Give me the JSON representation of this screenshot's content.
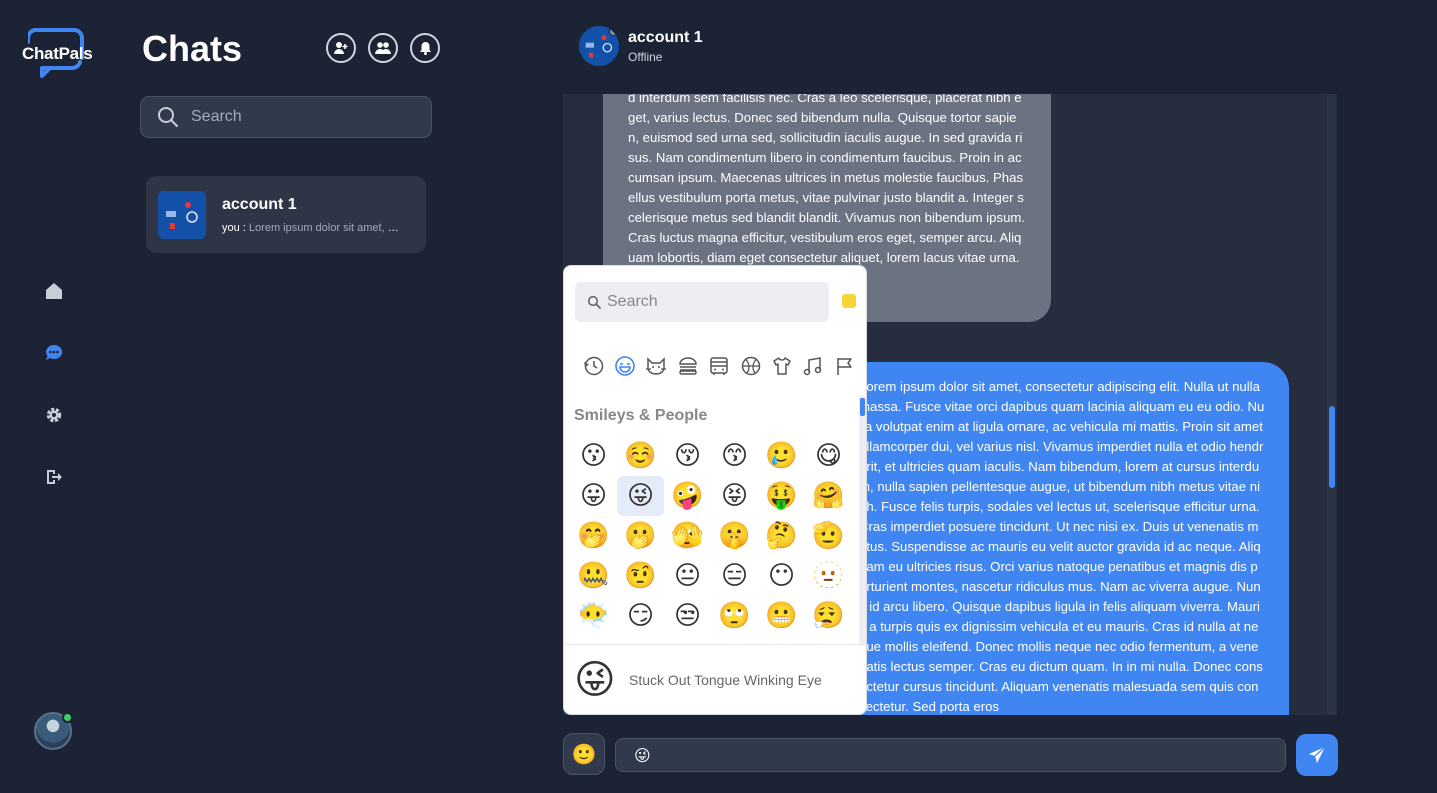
{
  "app": {
    "logo_text": "ChatPals",
    "accent_color": "#3f86f2",
    "background_color": "#1b2335"
  },
  "rail": {
    "items": [
      {
        "icon": "home-icon",
        "active": false
      },
      {
        "icon": "chat-icon",
        "active": true
      },
      {
        "icon": "gear-icon",
        "active": false
      },
      {
        "icon": "logout-icon",
        "active": false
      }
    ],
    "user_online": true
  },
  "chats_panel": {
    "title": "Chats",
    "header_buttons": [
      "add-user-icon",
      "group-icon",
      "bell-icon"
    ],
    "search_placeholder": "Search",
    "conversations": [
      {
        "name": "account 1",
        "preview_prefix": "you :",
        "preview_text": "Lorem ipsum dolor sit amet, consectetur adipiscing elit."
      }
    ]
  },
  "conversation": {
    "contact_name": "account 1",
    "contact_status": "Offline",
    "messages": [
      {
        "direction": "incoming",
        "text": "d interdum sem facilisis nec. Cras a leo scelerisque, placerat nibh eget, varius lectus. Donec sed bibendum nulla. Quisque tortor sapien, euismod sed urna sed, sollicitudin iaculis augue. In sed gravida risus. Nam condimentum libero in condimentum faucibus. Proin in accumsan ipsum. Maecenas ultrices in metus molestie faucibus. Phasellus vestibulum porta metus, vitae pulvinar justo blandit a. Integer scelerisque metus sed blandit blandit. Vivamus non bibendum ipsum. Cras luctus magna efficitur, vestibulum eros eget, semper arcu. Aliquam lobortis, diam eget consectetur aliquet, lorem lacus vitae urna. Sed varius, massa"
      },
      {
        "direction": "outgoing",
        "text": "Lorem ipsum dolor sit amet, consectetur adipiscing elit. Nulla ut nulla massa. Fusce vitae orci dapibus quam lacinia aliquam eu eu odio. Nulla volutpat enim at ligula ornare, ac vehicula mi mattis. Proin sit amet ullamcorper dui, vel varius nisl. Vivamus imperdiet nulla et odio hendrerit, et ultricies quam iaculis. Nam bibendum, lorem at cursus interdum, nulla sapien pellentesque augue, ut bibendum nibh metus vitae nibh. Fusce felis turpis, sodales vel lectus ut, scelerisque efficitur urna. Cras imperdiet posuere tincidunt. Ut nec nisi ex. Duis ut venenatis metus. Suspendisse ac mauris eu velit auctor gravida id ac neque. Aliquam eu ultricies risus. Orci varius natoque penatibus et magnis dis parturient montes, nascetur ridiculus mus. Nam ac viverra augue. Nunc id arcu libero. Quisque dapibus ligula in felis aliquam viverra. Mauris a turpis quis ex dignissim vehicula et eu mauris. Cras id nulla at neque mollis eleifend. Donec mollis neque nec odio fermentum, a venenatis lectus semper. Cras eu dictum quam. In in mi nulla. Donec consectetur cursus tincidunt. Aliquam venenatis malesuada sem quis consectetur. Sed porta eros"
      }
    ]
  },
  "emoji_picker": {
    "search_placeholder": "Search",
    "skin_tone_color": "#f7d539",
    "categories": [
      "clock-icon",
      "smiley-icon",
      "cat-icon",
      "burger-icon",
      "bus-icon",
      "ball-icon",
      "shirt-icon",
      "music-note-icon",
      "flag-icon"
    ],
    "active_category": 1,
    "section_title": "Smileys & People",
    "emojis": [
      "😗",
      "☺️",
      "😚",
      "😙",
      "🥲",
      "😋",
      "😛",
      "😜",
      "🤪",
      "😝",
      "🤑",
      "🤗",
      "🤭",
      "🫢",
      "🫣",
      "🤫",
      "🤔",
      "🫡",
      "🤐",
      "🤨",
      "😐",
      "😑",
      "😶",
      "🫥",
      "😶‍🌫️",
      "😏",
      "😒",
      "🙄",
      "😬",
      "😮‍💨"
    ],
    "selected_index": 7,
    "preview_emoji": "😜",
    "preview_name": "Stuck Out Tongue Winking Eye"
  },
  "composer": {
    "emoji_button": "🙂",
    "message_value": "😜",
    "send_icon": "paper-plane-icon"
  }
}
